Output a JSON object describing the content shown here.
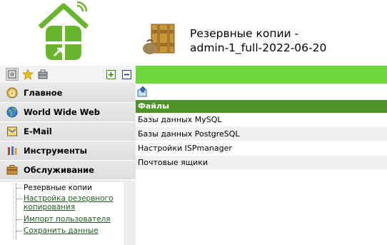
{
  "header": {
    "title_line1": "Резервные копии -",
    "title_line2": "admin-1_full-2022-06-20"
  },
  "sidebar": {
    "toolbar": [
      "list-icon",
      "star-icon",
      "briefcase-icon",
      "expand-all-icon",
      "collapse-all-icon"
    ],
    "items": [
      {
        "label": "Главное",
        "icon": "home-icon"
      },
      {
        "label": "World Wide Web",
        "icon": "globe-icon"
      },
      {
        "label": "E-Mail",
        "icon": "mail-icon"
      },
      {
        "label": "Инструменты",
        "icon": "tools-icon"
      },
      {
        "label": "Обслуживание",
        "icon": "maintenance-icon"
      }
    ],
    "subitems": [
      {
        "label": "Резервные копии"
      },
      {
        "label": "Настройка резервного копирования"
      },
      {
        "label": "Импорт пользователя"
      },
      {
        "label": "Сохранить данные"
      }
    ]
  },
  "main": {
    "table_header": "Файлы",
    "rows": [
      {
        "label": "Базы данных MySQL"
      },
      {
        "label": "Базы данных PostgreSQL"
      },
      {
        "label": "Настройки ISPmanager"
      },
      {
        "label": "Почтовые ящики"
      }
    ]
  },
  "colors": {
    "accent": "#6ed83b",
    "table_header": "#4e9228",
    "logo": "#6ab52e"
  }
}
